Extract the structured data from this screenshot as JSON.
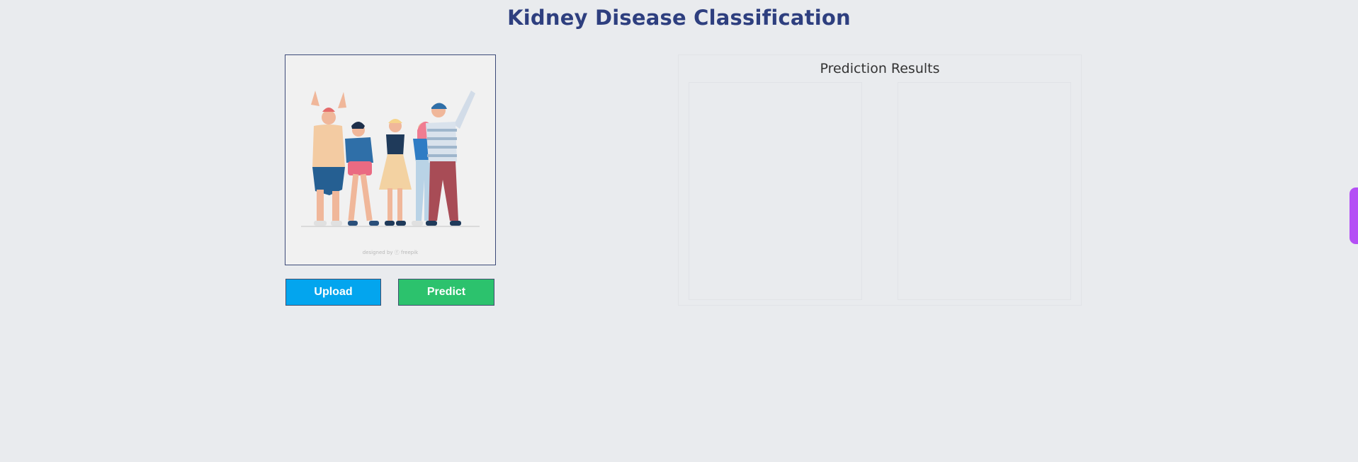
{
  "header": {
    "title": "Kidney Disease Classification"
  },
  "image_panel": {
    "illustration_icon": "group-of-people-cheering-illustration",
    "credit_text": "designed by ⓕ freepik"
  },
  "buttons": {
    "upload_label": "Upload",
    "predict_label": "Predict"
  },
  "results": {
    "title": "Prediction Results"
  },
  "colors": {
    "title": "#2e3f7f",
    "upload_button": "#03a5ee",
    "predict_button": "#2cc26d",
    "background": "#e9ebee",
    "side_tab": "#b44ff5"
  }
}
